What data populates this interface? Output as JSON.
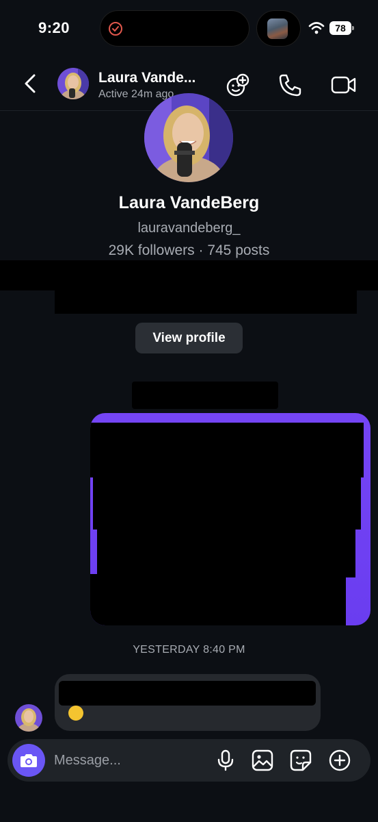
{
  "status_bar": {
    "time": "9:20",
    "battery": "78",
    "icons": [
      "timer-icon",
      "wifi-icon",
      "battery-icon"
    ]
  },
  "header": {
    "name": "Laura Vande...",
    "status": "Active 24m ago",
    "icons": [
      "back-chevron-icon",
      "add-people-icon",
      "phone-icon",
      "video-camera-icon"
    ]
  },
  "profile": {
    "name": "Laura VandeBerg",
    "handle": "lauravandeberg_",
    "stats": "29K followers · 745 posts",
    "view_profile_label": "View profile"
  },
  "messages": {
    "day_label": "YESTERDAY 8:40 PM",
    "outgoing_color": "#7545f5",
    "incoming_color": "#26292e"
  },
  "composer": {
    "placeholder": "Message...",
    "icons": [
      "camera-icon",
      "microphone-icon",
      "gallery-icon",
      "sticker-icon",
      "plus-icon"
    ]
  },
  "colors": {
    "background": "#0c0f14",
    "accent": "#6a56f5",
    "secondary_text": "#a8acb3"
  }
}
